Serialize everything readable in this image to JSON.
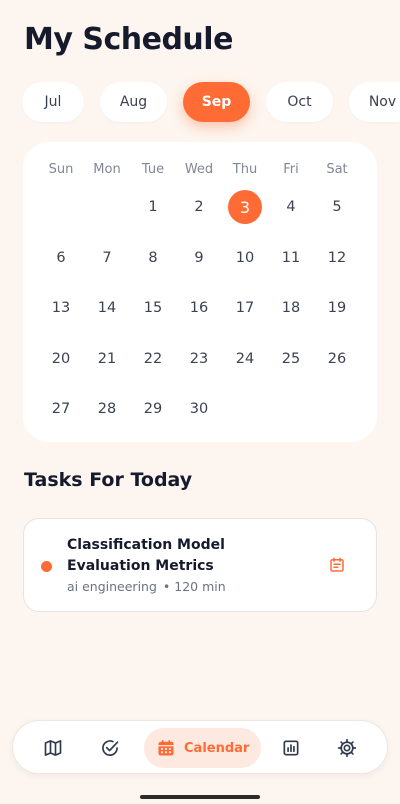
{
  "header": {
    "title": "My Schedule"
  },
  "months": [
    {
      "label": "Jul",
      "active": false
    },
    {
      "label": "Aug",
      "active": false
    },
    {
      "label": "Sep",
      "active": true
    },
    {
      "label": "Oct",
      "active": false
    },
    {
      "label": "Nov",
      "active": false
    }
  ],
  "calendar": {
    "weekdays": [
      "Sun",
      "Mon",
      "Tue",
      "Wed",
      "Thu",
      "Fri",
      "Sat"
    ],
    "days": [
      "",
      "",
      "1",
      "2",
      "3",
      "4",
      "5",
      "6",
      "7",
      "8",
      "9",
      "10",
      "11",
      "12",
      "13",
      "14",
      "15",
      "16",
      "17",
      "18",
      "19",
      "20",
      "21",
      "22",
      "23",
      "24",
      "25",
      "26",
      "27",
      "28",
      "29",
      "30"
    ],
    "today": "3"
  },
  "tasks_section": {
    "title": "Tasks For Today",
    "tasks": [
      {
        "title": "Classification Model Evaluation Metrics",
        "category": "ai engineering",
        "separator": "•",
        "duration": "120 min",
        "icon": "calendar-icon"
      }
    ]
  },
  "bottom_nav": {
    "items": [
      {
        "icon": "map-icon",
        "label": "",
        "active": false
      },
      {
        "icon": "check-circle-icon",
        "label": "",
        "active": false
      },
      {
        "icon": "calendar-icon",
        "label": "Calendar",
        "active": true
      },
      {
        "icon": "chart-icon",
        "label": "",
        "active": false
      },
      {
        "icon": "gear-icon",
        "label": "",
        "active": false
      }
    ]
  },
  "colors": {
    "accent": "#ff6b35",
    "background": "#fdf5ef",
    "card": "#ffffff",
    "text_dark": "#151b2c",
    "text_muted": "#7f8796"
  }
}
